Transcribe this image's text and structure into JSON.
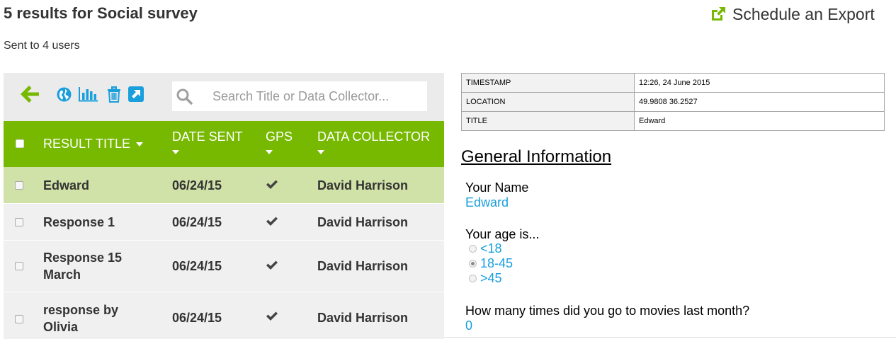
{
  "header": {
    "title": "5 results for Social survey",
    "export_label": "Schedule an Export",
    "subtitle": "Sent to 4 users"
  },
  "toolbar": {
    "icons": [
      "back-arrow-icon",
      "globe-icon",
      "bar-chart-icon",
      "trash-icon",
      "external-link-icon"
    ],
    "search_placeholder": "Search Title or Data Collector..."
  },
  "table": {
    "columns": {
      "title": "RESULT TITLE",
      "date": "DATE SENT",
      "gps": "GPS",
      "collector": "DATA COLLECTOR"
    },
    "rows": [
      {
        "title": "Edward",
        "date": "06/24/15",
        "gps": true,
        "collector": "David Harrison",
        "selected": true
      },
      {
        "title": "Response 1",
        "date": "06/24/15",
        "gps": true,
        "collector": "David Harrison",
        "selected": false
      },
      {
        "title": "Response 15 March",
        "date": "06/24/15",
        "gps": true,
        "collector": "David Harrison",
        "selected": false
      },
      {
        "title": "response by Olivia",
        "date": "06/24/15",
        "gps": true,
        "collector": "David Harrison",
        "selected": false
      }
    ]
  },
  "detail": {
    "meta": [
      {
        "key": "TIMESTAMP",
        "value": "12:26, 24 June 2015"
      },
      {
        "key": "LOCATION",
        "value": "49.9808 36.2527"
      },
      {
        "key": "TITLE",
        "value": "Edward"
      }
    ],
    "section_title": "General Information",
    "q1": {
      "question": "Your Name",
      "answer": "Edward"
    },
    "q2": {
      "question": "Your age is...",
      "options": [
        {
          "label": "<18",
          "checked": false
        },
        {
          "label": "18-45",
          "checked": true
        },
        {
          "label": ">45",
          "checked": false
        }
      ]
    },
    "q3": {
      "question": "How many times did you go to movies last month?",
      "answer": "0"
    }
  },
  "colors": {
    "accent_green": "#77b800",
    "selected_row": "#d1e2a8",
    "link_blue": "#1a9fdd"
  }
}
